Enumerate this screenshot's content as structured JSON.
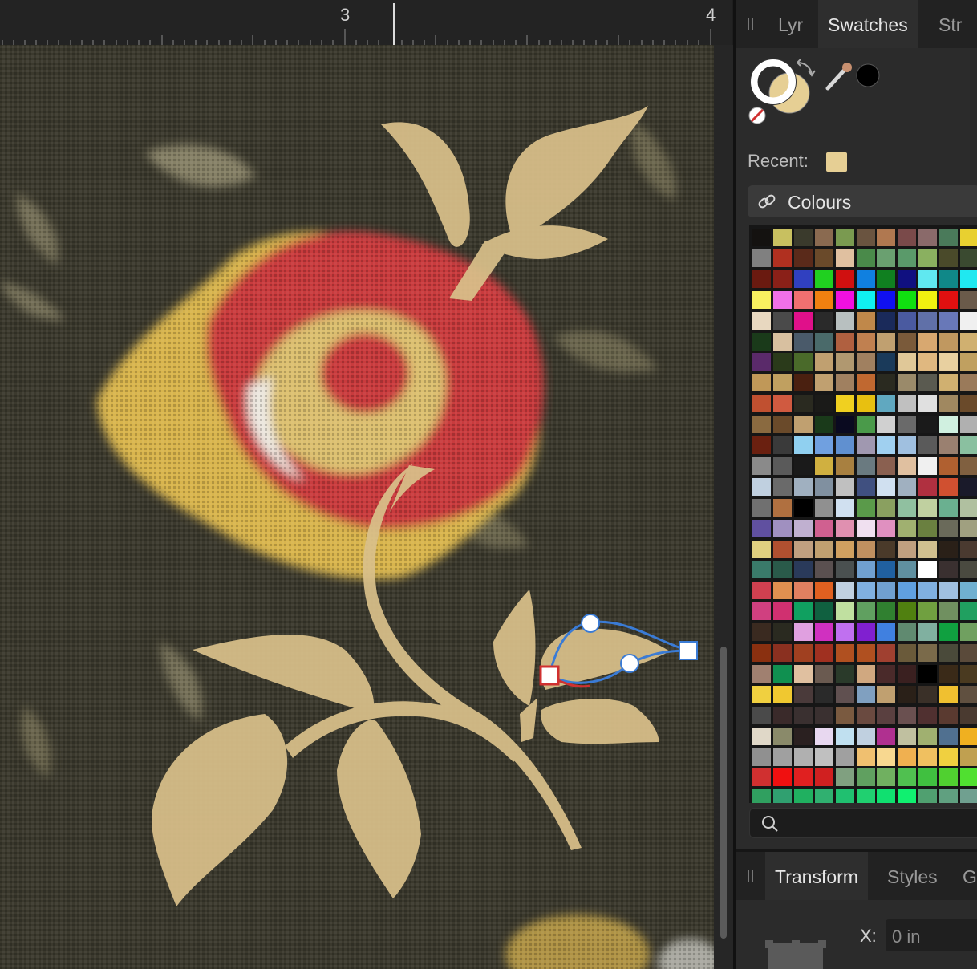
{
  "ruler": {
    "label_left": "3",
    "label_right": "4"
  },
  "panel_tabs": [
    {
      "label": "Lyr",
      "active": false
    },
    {
      "label": "Swatches",
      "active": true
    },
    {
      "label": "Str",
      "active": false
    }
  ],
  "recent": {
    "label": "Recent:",
    "swatch_color": "#e6cf94"
  },
  "palette": {
    "name": "Colours"
  },
  "search": {
    "placeholder": ""
  },
  "bottom_tabs": [
    {
      "label": "Transform",
      "active": true
    },
    {
      "label": "Styles",
      "active": false
    },
    {
      "label": "G",
      "active": false
    }
  ],
  "transform": {
    "x_label": "X:",
    "x_value": "0 in"
  },
  "colors": {
    "fill": "#e6cf94",
    "stroke": "#ffffff",
    "eyedropper_color": "#000000",
    "shape_fill": "#d9c08a",
    "flower_red": "#c93a3c",
    "flower_yellow": "#d9b54e",
    "selection_blue": "#3a7bd5"
  },
  "swatch_rows": [
    [
      "#141210",
      "#c8c060",
      "#3a3a2c",
      "#8a6a50",
      "#7a9a50",
      "#6a5440",
      "#b07850",
      "#7a4a4a",
      "#8a6a6a",
      "#4a7a5a",
      "#e8d030"
    ],
    [
      "#808080",
      "#b03020",
      "#5a2a1a",
      "#6a4a2a",
      "#e0c0a0",
      "#4a8a4a",
      "#6aa070",
      "#5a9a6a",
      "#8ab060",
      "#4a4a2a",
      "#3a4a30"
    ],
    [
      "#6a1a10",
      "#8a2018",
      "#3040c0",
      "#20d020",
      "#d01010",
      "#1080e0",
      "#108020",
      "#101080",
      "#60e8f0",
      "#108888",
      "#20e8f0"
    ],
    [
      "#f8f060",
      "#f070e8",
      "#f07070",
      "#f08010",
      "#f010e0",
      "#10f0f0",
      "#1010f0",
      "#10e010",
      "#f0f010",
      "#e01010",
      "#6a5a4a"
    ],
    [
      "#e8d8c0",
      "#4a4a4a",
      "#e0108a",
      "#2a2a2a",
      "#b8c0c0",
      "#c0884a",
      "#1a2a5a",
      "#4a5aa0",
      "#6070a8",
      "#6878b8",
      "#f0f0f0"
    ],
    [
      "#1a3a1a",
      "#d8c0a0",
      "#4a5a6a",
      "#4a6a6a",
      "#b06040",
      "#c08050",
      "#c0a070",
      "#7a5a3a",
      "#d8a870",
      "#c09860",
      "#d0b070"
    ],
    [
      "#5a2a6a",
      "#2a3a1a",
      "#4a6a2a",
      "#c0a070",
      "#b09870",
      "#a08060",
      "#1a3a5a",
      "#e0c898",
      "#e0b880",
      "#e8d0a0",
      "#c0a060"
    ],
    [
      "#c09858",
      "#c0a060",
      "#4a2010",
      "#c0a070",
      "#a08060",
      "#c06830",
      "#2a2a20",
      "#9a8a6a",
      "#5a5a50",
      "#d0b070",
      "#9a7a5a"
    ],
    [
      "#c05030",
      "#d05a40",
      "#2a2a20",
      "#1a1a18",
      "#f0d020",
      "#e8c010",
      "#60a8c0",
      "#c0c0c0",
      "#e0e0e0",
      "#a08860",
      "#6a4a2a"
    ],
    [
      "#8a6a40",
      "#6a4a2a",
      "#c0a070",
      "#1a3a1a",
      "#0a0a20",
      "#4a9a4a",
      "#d0d0d0",
      "#6a6a6a",
      "#1a1a1a",
      "#d0f0e0",
      "#b0b0b0"
    ],
    [
      "#6a2010",
      "#3a3a3a",
      "#90d0f0",
      "#70a0e0",
      "#6090d0",
      "#a098b0",
      "#a0d0f0",
      "#a0c0e0",
      "#5a5a5a",
      "#9a8070",
      "#8ac0a0"
    ],
    [
      "#8a8a8a",
      "#5a5a5a",
      "#1a1a1a",
      "#d0b040",
      "#a88040",
      "#6a7a80",
      "#8a6050",
      "#e0c0a0",
      "#f0f0f0",
      "#b06030",
      "#806040"
    ],
    [
      "#c0d0e0",
      "#6a6a6a",
      "#a0b0c0",
      "#8090a0",
      "#c0c0c0",
      "#405080",
      "#d0e0f0",
      "#a0b0c0",
      "#b03040",
      "#d05030",
      "#1a1a2a"
    ],
    [
      "#707070",
      "#b07040",
      "#000000",
      "#909090",
      "#d0e0f0",
      "#5a9a4a",
      "#8aa060",
      "#90c0a0",
      "#c0d0a0",
      "#6ab090",
      "#b0c0a0"
    ],
    [
      "#6050a0",
      "#a090c0",
      "#c0b0d0",
      "#d06090",
      "#e090b0",
      "#f0e0f0",
      "#e090c0",
      "#a0b070",
      "#6a8040",
      "#6a6a5a",
      "#a0a080"
    ],
    [
      "#e0d080",
      "#b05030",
      "#c0a080",
      "#c0a070",
      "#d0a060",
      "#c09060",
      "#4a3a2a",
      "#c0a080",
      "#d0c090",
      "#2a2018",
      "#4a3a30"
    ],
    [
      "#3a7a6a",
      "#2a5a4a",
      "#2a3a5a",
      "#5a5050",
      "#4a5050",
      "#70a0d0",
      "#2060a0",
      "#6090a0",
      "#ffffff",
      "#3a3030",
      "#4a4a40"
    ],
    [
      "#d04050",
      "#e09050",
      "#e08060",
      "#e06020",
      "#c0d0e0",
      "#80b0e0",
      "#70a0d0",
      "#60a0e0",
      "#80b0e0",
      "#a0c0e0",
      "#70b0d0"
    ],
    [
      "#d04080",
      "#d03070",
      "#10a060",
      "#106040",
      "#c0e0a0",
      "#60a060",
      "#308030",
      "#508010",
      "#70a040",
      "#709060",
      "#20a060"
    ],
    [
      "#3a2a20",
      "#2a2a20",
      "#e0a0e0",
      "#d030c0",
      "#c070f0",
      "#8020d0",
      "#4080e0",
      "#608a70",
      "#80b0a0",
      "#10a040",
      "#70a060"
    ],
    [
      "#8a3010",
      "#8a3020",
      "#a04020",
      "#a03020",
      "#b05020",
      "#b05020",
      "#a04030",
      "#6a5a3a",
      "#7a6a4a",
      "#4a4a3a",
      "#5a4a3a"
    ],
    [
      "#a08070",
      "#109050",
      "#e0c0a0",
      "#6a5a50",
      "#2a3a2a",
      "#d0a880",
      "#4a2a2a",
      "#3a2020",
      "#000000",
      "#3a2a18",
      "#4a3a20"
    ],
    [
      "#f0d040",
      "#f0c830",
      "#4a3a3a",
      "#2a2a2a",
      "#605050",
      "#80a0c0",
      "#c0a070",
      "#2a2018",
      "#3a3028",
      "#f0c030",
      "#605040"
    ],
    [
      "#4a4a4a",
      "#3a2a2a",
      "#3a3030",
      "#3a3030",
      "#7a5a40",
      "#6a4a40",
      "#5a4040",
      "#6a5050",
      "#503030",
      "#5a3a30",
      "#4a3a30"
    ],
    [
      "#e0d8c8",
      "#8a8a6a",
      "#2a2020",
      "#e8d8f0",
      "#c0e0f0",
      "#c0d0e0",
      "#b03090",
      "#c0c0a0",
      "#a0b070",
      "#507090",
      "#f0b020"
    ],
    [
      "#909090",
      "#a0a0a0",
      "#b0b0b0",
      "#c0c0c0",
      "#a0a0a0",
      "#f0c070",
      "#f8d890",
      "#f0b050",
      "#f0c060",
      "#f0d040",
      "#c0a050"
    ],
    [
      "#d03030",
      "#f01010",
      "#e02020",
      "#d02020",
      "#80a080",
      "#60a060",
      "#70b060",
      "#50c050",
      "#40c040",
      "#50d030",
      "#50e030"
    ],
    [
      "#30a060",
      "#30a070",
      "#20b060",
      "#30b070",
      "#20c070",
      "#20d070",
      "#10e070",
      "#10f070",
      "#50a070",
      "#60a080",
      "#70a090"
    ]
  ]
}
